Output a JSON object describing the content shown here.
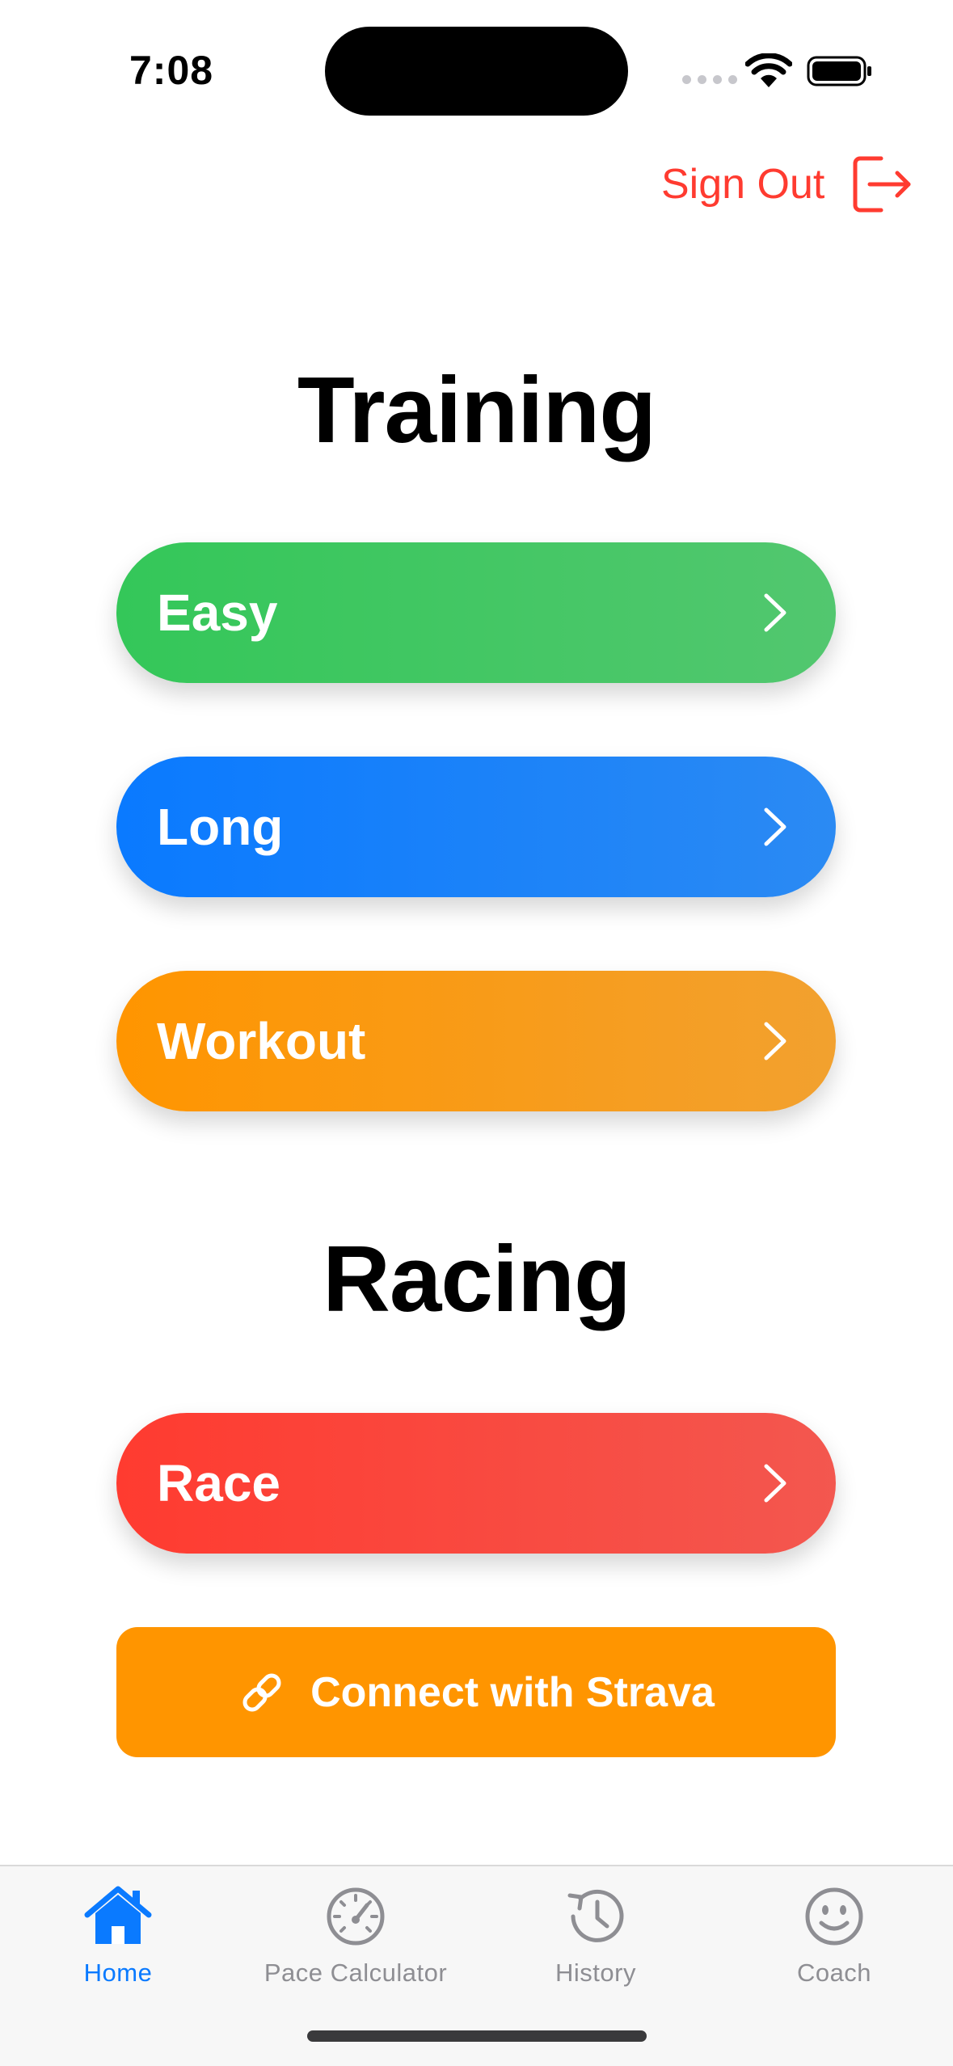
{
  "status_bar": {
    "time": "7:08"
  },
  "header": {
    "sign_out_label": "Sign Out",
    "sign_out_icon": "sign-out-icon"
  },
  "sections": {
    "training_title": "Training",
    "racing_title": "Racing"
  },
  "run_types": {
    "easy": {
      "label": "Easy",
      "color": "#34c759"
    },
    "long": {
      "label": "Long",
      "color": "#0a7aff"
    },
    "workout": {
      "label": "Workout",
      "color": "#ff9500"
    },
    "race": {
      "label": "Race",
      "color": "#ff3b30"
    }
  },
  "strava": {
    "label": "Connect with Strava",
    "icon": "link-icon",
    "color": "#ff9500"
  },
  "tab_bar": {
    "active": "Home",
    "accent_color": "#0a7aff",
    "tabs": [
      {
        "label": "Home",
        "icon": "house-icon"
      },
      {
        "label": "Pace Calculator",
        "icon": "gauge-icon"
      },
      {
        "label": "History",
        "icon": "history-clock-icon"
      },
      {
        "label": "Coach",
        "icon": "smiley-icon"
      }
    ]
  }
}
